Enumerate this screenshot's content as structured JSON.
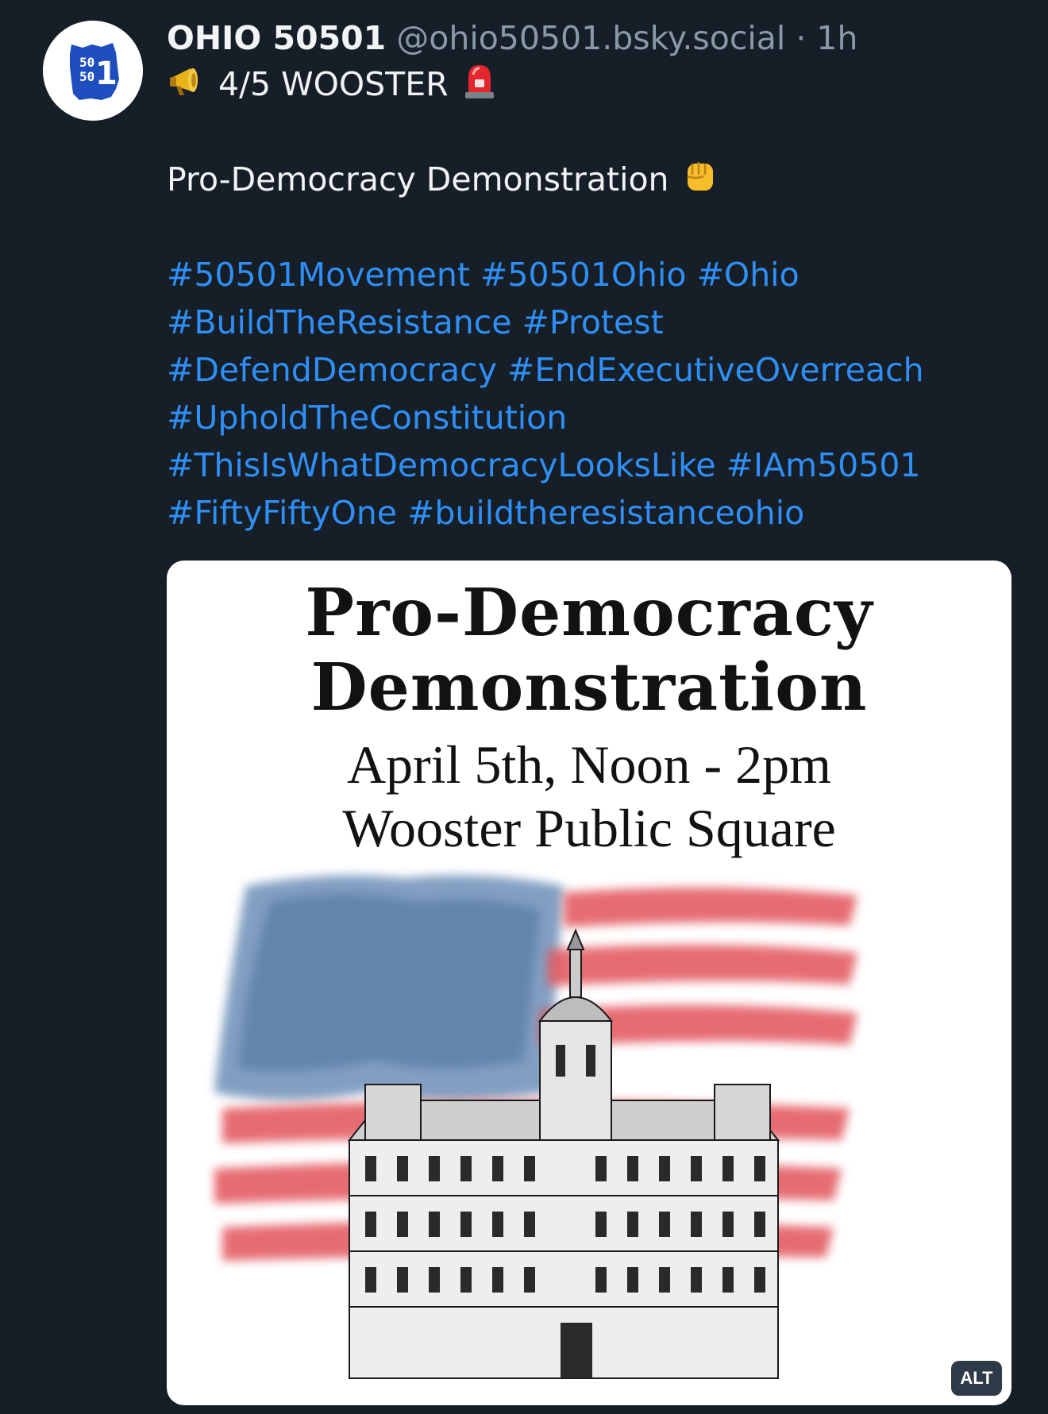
{
  "post": {
    "author": {
      "display_name": "OHIO 50501",
      "handle": "@ohio50501.bsky.social",
      "separator": "·",
      "time": "1h",
      "avatar_text_top": "50",
      "avatar_text_mid": "50",
      "avatar_text_big": "1"
    },
    "text": {
      "line1": "4/5 WOOSTER",
      "line2": "Pro-Democracy Demonstration",
      "emoji_line1_before": "megaphone-icon",
      "emoji_line1_after": "police-light-icon",
      "emoji_line2_after": "raised-fist-icon"
    },
    "hashtags": [
      [
        "#50501Movement",
        "#50501Ohio",
        "#Ohio"
      ],
      [
        "#BuildTheResistance",
        "#Protest"
      ],
      [
        "#DefendDemocracy",
        "#EndExecutiveOverreach"
      ],
      [
        "#UpholdTheConstitution"
      ],
      [
        "#ThisIsWhatDemocracyLooksLike",
        "#IAm50501"
      ],
      [
        "#FiftyFiftyOne",
        "#buildtheresistanceohio"
      ]
    ],
    "image": {
      "title_line1": "Pro-Democracy",
      "title_line2": "Demonstration",
      "date_line": "April 5th, Noon - 2pm",
      "place_line": "Wooster Public Square",
      "alt_label": "ALT"
    }
  },
  "colors": {
    "background": "#161e27",
    "link": "#2f8ff5",
    "muted": "#8a99aa",
    "text": "#f1f3f5",
    "brand_blue": "#1f4fbf"
  }
}
